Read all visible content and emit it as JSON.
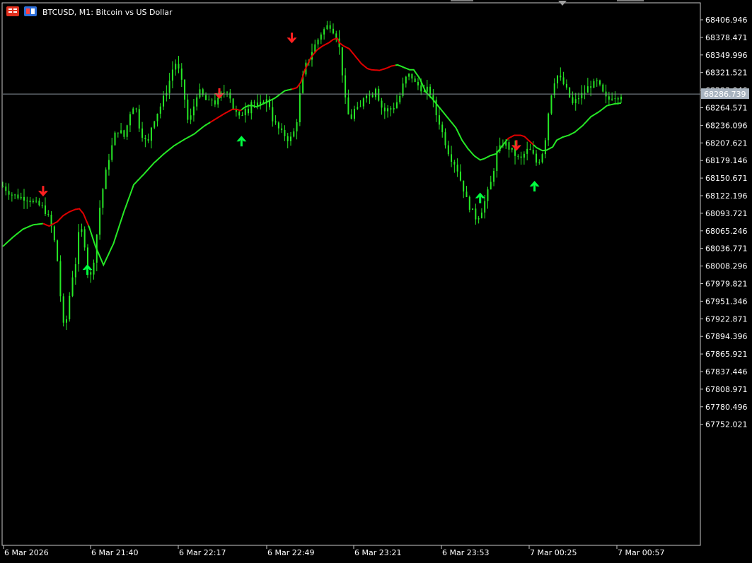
{
  "header": {
    "symbol_line": "BTCUSD, M1:  Bitcoin vs US Dollar"
  },
  "price_tag": {
    "label": "68286.739"
  },
  "colors": {
    "background": "#000000",
    "candle": "#26e826",
    "up_trend": "#26e826",
    "down_trend": "#e00000",
    "arrow_up": "#00ff40",
    "arrow_down": "#ff2020",
    "grid_line": "#9aa4b0",
    "price_tag_bg": "#a9b4c0"
  },
  "chart_data": {
    "type": "candlestick",
    "timeframe": "M1",
    "current_price": 68286.739,
    "price_ylim": [
      67737.0,
      68420.0
    ],
    "y_ticks": [
      "68406.946",
      "68378.471",
      "68349.996",
      "68321.521",
      "68293.046",
      "68264.571",
      "68236.096",
      "68207.621",
      "68179.146",
      "68150.671",
      "68122.196",
      "68093.721",
      "68065.246",
      "68036.771",
      "68008.296",
      "67979.821",
      "67951.346",
      "67922.871",
      "67894.396",
      "67865.921",
      "67837.446",
      "67808.971",
      "67780.496",
      "67752.021"
    ],
    "x_ticks": [
      "6 Mar 2026",
      "6 Mar 21:40",
      "6 Mar 22:17",
      "6 Mar 22:49",
      "6 Mar 23:21",
      "6 Mar 23:53",
      "7 Mar 00:25",
      "7 Mar 00:57"
    ],
    "close_path": [
      [
        0,
        68137
      ],
      [
        8,
        68125
      ],
      [
        16,
        68120
      ],
      [
        24,
        68118
      ],
      [
        32,
        68110
      ],
      [
        40,
        68103
      ],
      [
        46,
        68085
      ],
      [
        50,
        68060
      ],
      [
        54,
        68020
      ],
      [
        58,
        67945
      ],
      [
        61,
        67900
      ],
      [
        64,
        67930
      ],
      [
        68,
        67985
      ],
      [
        72,
        68010
      ],
      [
        76,
        68070
      ],
      [
        80,
        68062
      ],
      [
        84,
        68002
      ],
      [
        88,
        67990
      ],
      [
        92,
        68040
      ],
      [
        96,
        68100
      ],
      [
        100,
        68140
      ],
      [
        104,
        68175
      ],
      [
        108,
        68200
      ],
      [
        112,
        68225
      ],
      [
        116,
        68230
      ],
      [
        120,
        68215
      ],
      [
        124,
        68240
      ],
      [
        128,
        68268
      ],
      [
        132,
        68265
      ],
      [
        136,
        68230
      ],
      [
        140,
        68215
      ],
      [
        144,
        68205
      ],
      [
        148,
        68238
      ],
      [
        152,
        68252
      ],
      [
        156,
        68265
      ],
      [
        160,
        68282
      ],
      [
        164,
        68298
      ],
      [
        168,
        68325
      ],
      [
        172,
        68338
      ],
      [
        176,
        68318
      ],
      [
        180,
        68285
      ],
      [
        184,
        68240
      ],
      [
        188,
        68255
      ],
      [
        192,
        68285
      ],
      [
        196,
        68290
      ],
      [
        200,
        68280
      ],
      [
        204,
        68272
      ],
      [
        208,
        68278
      ],
      [
        212,
        68270
      ],
      [
        216,
        68285
      ],
      [
        220,
        68290
      ],
      [
        224,
        68295
      ],
      [
        228,
        68265
      ],
      [
        232,
        68255
      ],
      [
        236,
        68245
      ],
      [
        240,
        68268
      ],
      [
        244,
        68260
      ],
      [
        248,
        68282
      ],
      [
        252,
        68262
      ],
      [
        256,
        68270
      ],
      [
        260,
        68278
      ],
      [
        264,
        68274
      ],
      [
        268,
        68245
      ],
      [
        272,
        68235
      ],
      [
        276,
        68225
      ],
      [
        280,
        68220
      ],
      [
        284,
        68212
      ],
      [
        288,
        68219
      ],
      [
        292,
        68245
      ],
      [
        296,
        68300
      ],
      [
        300,
        68330
      ],
      [
        304,
        68345
      ],
      [
        308,
        68360
      ],
      [
        312,
        68372
      ],
      [
        316,
        68385
      ],
      [
        320,
        68393
      ],
      [
        324,
        68400
      ],
      [
        328,
        68390
      ],
      [
        332,
        68378
      ],
      [
        336,
        68345
      ],
      [
        338,
        68300
      ],
      [
        342,
        68255
      ],
      [
        346,
        68248
      ],
      [
        350,
        68265
      ],
      [
        354,
        68258
      ],
      [
        358,
        68282
      ],
      [
        362,
        68290
      ],
      [
        366,
        68280
      ],
      [
        370,
        68300
      ],
      [
        374,
        68275
      ],
      [
        378,
        68258
      ],
      [
        382,
        68262
      ],
      [
        386,
        68262
      ],
      [
        390,
        68270
      ],
      [
        394,
        68282
      ],
      [
        398,
        68305
      ],
      [
        402,
        68318
      ],
      [
        406,
        68315
      ],
      [
        410,
        68302
      ],
      [
        414,
        68300
      ],
      [
        418,
        68288
      ],
      [
        422,
        68295
      ],
      [
        426,
        68283
      ],
      [
        430,
        68255
      ],
      [
        434,
        68238
      ],
      [
        438,
        68215
      ],
      [
        442,
        68195
      ],
      [
        446,
        68180
      ],
      [
        450,
        68172
      ],
      [
        454,
        68150
      ],
      [
        458,
        68130
      ],
      [
        462,
        68108
      ],
      [
        466,
        68098
      ],
      [
        470,
        68085
      ],
      [
        474,
        68092
      ],
      [
        478,
        68110
      ],
      [
        482,
        68130
      ],
      [
        486,
        68150
      ],
      [
        490,
        68190
      ],
      [
        494,
        68200
      ],
      [
        498,
        68210
      ],
      [
        502,
        68200
      ],
      [
        506,
        68195
      ],
      [
        510,
        68185
      ],
      [
        514,
        68180
      ],
      [
        518,
        68190
      ],
      [
        522,
        68198
      ],
      [
        526,
        68190
      ],
      [
        530,
        68175
      ],
      [
        534,
        68182
      ],
      [
        538,
        68205
      ],
      [
        542,
        68260
      ],
      [
        546,
        68300
      ],
      [
        550,
        68318
      ],
      [
        554,
        68310
      ],
      [
        558,
        68300
      ],
      [
        562,
        68285
      ],
      [
        566,
        68270
      ],
      [
        570,
        68278
      ],
      [
        574,
        68285
      ],
      [
        578,
        68290
      ],
      [
        582,
        68300
      ],
      [
        586,
        68302
      ],
      [
        590,
        68306
      ],
      [
        594,
        68295
      ],
      [
        598,
        68280
      ],
      [
        602,
        68278
      ],
      [
        606,
        68285
      ],
      [
        610,
        68282
      ],
      [
        614,
        68286
      ]
    ],
    "trend_line": [
      [
        0,
        68040
      ],
      [
        10,
        68055
      ],
      [
        20,
        68068
      ],
      [
        30,
        68075
      ],
      [
        40,
        68077
      ],
      [
        46,
        68073
      ],
      [
        54,
        68080
      ],
      [
        60,
        68090
      ],
      [
        66,
        68096
      ],
      [
        72,
        68100
      ],
      [
        76,
        68101
      ],
      [
        80,
        68093
      ],
      [
        86,
        68070
      ],
      [
        92,
        68040
      ],
      [
        100,
        68010
      ],
      [
        110,
        68045
      ],
      [
        120,
        68095
      ],
      [
        130,
        68140
      ],
      [
        140,
        68157
      ],
      [
        150,
        68175
      ],
      [
        160,
        68190
      ],
      [
        170,
        68203
      ],
      [
        180,
        68213
      ],
      [
        190,
        68222
      ],
      [
        200,
        68235
      ],
      [
        210,
        68245
      ],
      [
        220,
        68255
      ],
      [
        228,
        68262
      ],
      [
        232,
        68262
      ],
      [
        236,
        68260
      ],
      [
        240,
        68265
      ],
      [
        244,
        68268
      ],
      [
        248,
        68268
      ],
      [
        252,
        68266
      ],
      [
        260,
        68272
      ],
      [
        270,
        68280
      ],
      [
        280,
        68292
      ],
      [
        288,
        68295
      ],
      [
        292,
        68297
      ],
      [
        296,
        68306
      ],
      [
        300,
        68326
      ],
      [
        306,
        68346
      ],
      [
        312,
        68358
      ],
      [
        318,
        68365
      ],
      [
        324,
        68370
      ],
      [
        328,
        68375
      ],
      [
        332,
        68377
      ],
      [
        334,
        68370
      ],
      [
        338,
        68365
      ],
      [
        344,
        68360
      ],
      [
        350,
        68348
      ],
      [
        356,
        68336
      ],
      [
        362,
        68328
      ],
      [
        366,
        68326
      ],
      [
        374,
        68325
      ],
      [
        380,
        68328
      ],
      [
        386,
        68332
      ],
      [
        392,
        68334
      ],
      [
        398,
        68330
      ],
      [
        404,
        68326
      ],
      [
        408,
        68326
      ],
      [
        414,
        68312
      ],
      [
        420,
        68290
      ],
      [
        426,
        68280
      ],
      [
        432,
        68268
      ],
      [
        440,
        68252
      ],
      [
        450,
        68232
      ],
      [
        456,
        68212
      ],
      [
        462,
        68198
      ],
      [
        468,
        68187
      ],
      [
        474,
        68180
      ],
      [
        478,
        68182
      ],
      [
        484,
        68187
      ],
      [
        490,
        68190
      ],
      [
        496,
        68203
      ],
      [
        502,
        68215
      ],
      [
        508,
        68220
      ],
      [
        514,
        68220
      ],
      [
        518,
        68218
      ],
      [
        524,
        68209
      ],
      [
        530,
        68200
      ],
      [
        536,
        68195
      ],
      [
        540,
        68196
      ],
      [
        546,
        68201
      ],
      [
        550,
        68212
      ],
      [
        556,
        68217
      ],
      [
        562,
        68220
      ],
      [
        568,
        68225
      ],
      [
        576,
        68236
      ],
      [
        584,
        68250
      ],
      [
        592,
        68258
      ],
      [
        600,
        68268
      ],
      [
        608,
        68271
      ],
      [
        614,
        68272
      ]
    ],
    "down_segments": [
      [
        40,
        84
      ],
      [
        206,
        236
      ],
      [
        287,
        389
      ],
      [
        501,
        526
      ]
    ],
    "arrows": [
      {
        "dir": "down",
        "t": 40,
        "price": 68130
      },
      {
        "dir": "up",
        "t": 84,
        "price": 68002
      },
      {
        "dir": "down",
        "t": 215,
        "price": 68288
      },
      {
        "dir": "up",
        "t": 237,
        "price": 68210
      },
      {
        "dir": "down",
        "t": 287,
        "price": 68378
      },
      {
        "dir": "up",
        "t": 474,
        "price": 68118
      },
      {
        "dir": "down",
        "t": 510,
        "price": 68204
      },
      {
        "dir": "up",
        "t": 528,
        "price": 68137
      }
    ],
    "x_extent": [
      0,
      640
    ],
    "candle_count": 205
  }
}
